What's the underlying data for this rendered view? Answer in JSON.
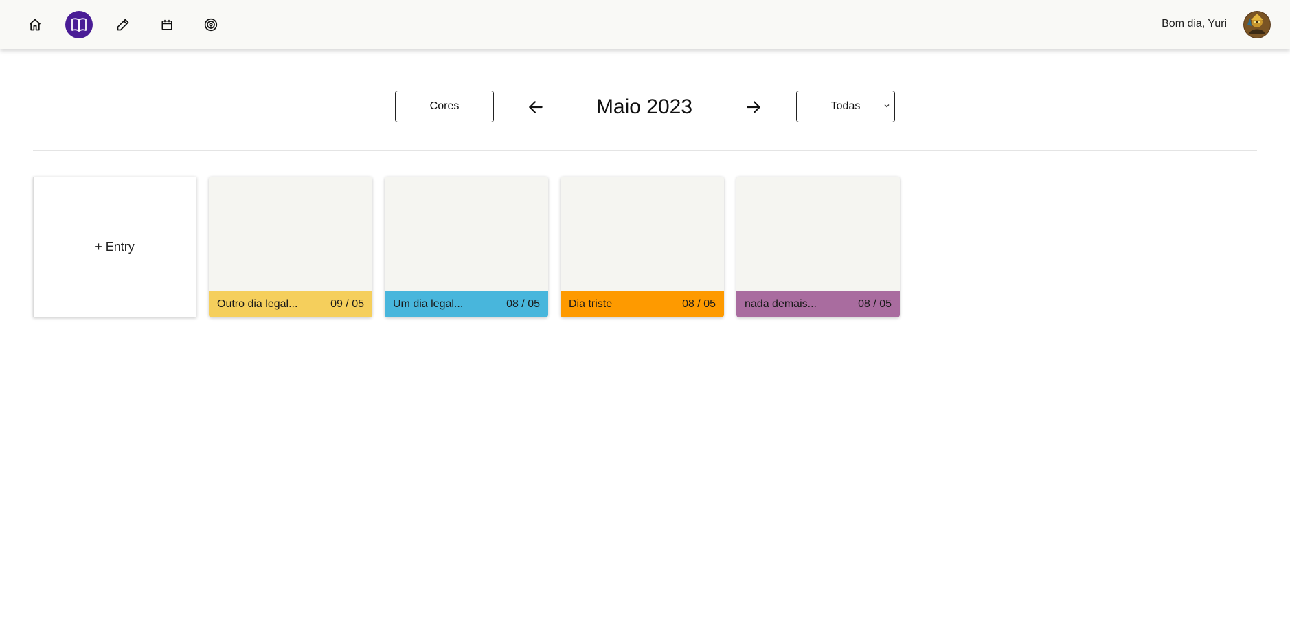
{
  "nav": {
    "items": [
      {
        "icon": "home-icon",
        "active": false
      },
      {
        "icon": "book-icon",
        "active": true
      },
      {
        "icon": "pencil-icon",
        "active": false
      },
      {
        "icon": "calendar-icon",
        "active": false
      },
      {
        "icon": "target-icon",
        "active": false
      }
    ],
    "active_color": "#4a1d96"
  },
  "user": {
    "greeting": "Bom dia, Yuri",
    "avatar_icon": "avatar"
  },
  "controls": {
    "colors_button": "Cores",
    "month_title": "Maio 2023",
    "prev_icon": "arrow-left-icon",
    "next_icon": "arrow-right-icon",
    "filter_selected": "Todas"
  },
  "add_entry": {
    "label": "+ Entry"
  },
  "entries": [
    {
      "title": "Outro dia legal...",
      "date": "09 / 05",
      "color": "#f5cf5c"
    },
    {
      "title": "Um dia legal...",
      "date": "08 / 05",
      "color": "#48b6dc"
    },
    {
      "title": "Dia triste",
      "date": "08 / 05",
      "color": "#fe9a00"
    },
    {
      "title": "nada demais...",
      "date": "08 / 05",
      "color": "#a96c9f"
    }
  ]
}
